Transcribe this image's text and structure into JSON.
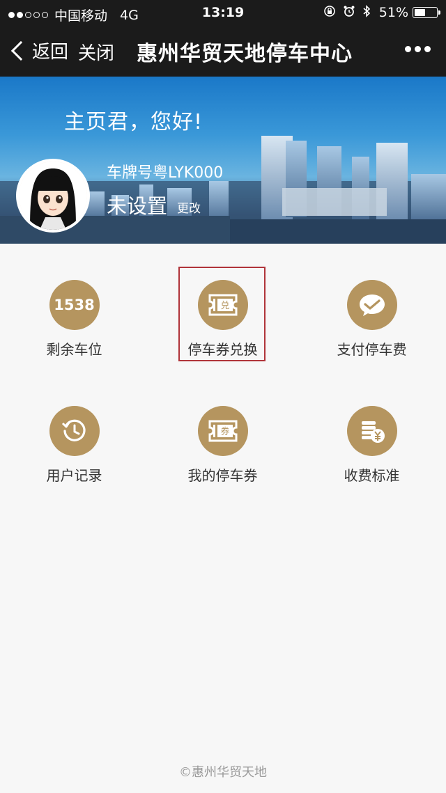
{
  "status_bar": {
    "carrier": "中国移动",
    "network": "4G",
    "time": "13:19",
    "battery": "51%",
    "battery_level": 0.51,
    "signal_bars_filled": 2,
    "signal_bars_total": 5
  },
  "nav": {
    "back_label": "返回",
    "close_label": "关闭",
    "title": "惠州华贸天地停车中心"
  },
  "banner": {
    "greeting": "主页君，您好!",
    "plate_label": "车牌号粤LYK000",
    "plate_status": "未设置",
    "edit_label": "更改"
  },
  "grid": {
    "items": [
      {
        "label": "剩余车位",
        "value": "1538",
        "icon": "parking-count"
      },
      {
        "label": "停车券兑换",
        "icon": "ticket-exchange-icon",
        "badge_text": "兑"
      },
      {
        "label": "支付停车费",
        "icon": "wechat-pay-icon"
      },
      {
        "label": "用户记录",
        "icon": "history-icon"
      },
      {
        "label": "我的停车券",
        "icon": "coupon-icon",
        "badge_text": "券"
      },
      {
        "label": "收费标准",
        "icon": "coins-yuan-icon"
      }
    ]
  },
  "footer": {
    "text": "©惠州华贸天地"
  },
  "colors": {
    "accent": "#b5955f",
    "nav_bg": "#1b1b1b",
    "highlight": "#b0343a"
  }
}
